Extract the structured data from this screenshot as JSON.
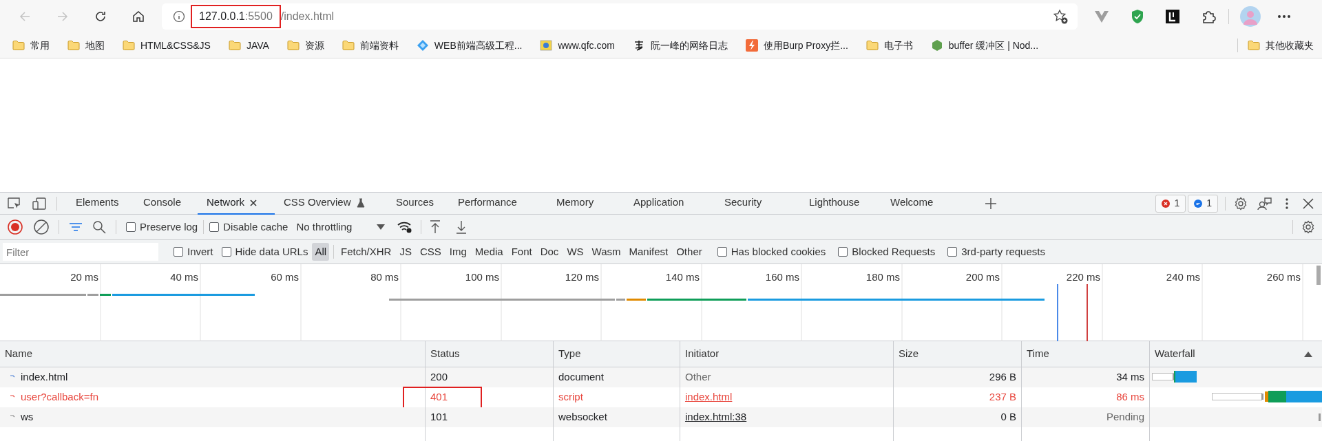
{
  "browser": {
    "url": {
      "host": "127.0.0.1",
      "port": ":5500",
      "path": "/index.html",
      "highlighted": true
    },
    "bookmarks": [
      {
        "label": "常用",
        "kind": "folder"
      },
      {
        "label": "地图",
        "kind": "folder"
      },
      {
        "label": "HTML&CSS&JS",
        "kind": "folder"
      },
      {
        "label": "JAVA",
        "kind": "folder"
      },
      {
        "label": "资源",
        "kind": "folder"
      },
      {
        "label": "前端资料",
        "kind": "folder"
      },
      {
        "label": "WEB前端高级工程...",
        "kind": "diamond"
      },
      {
        "label": "www.qfc.com",
        "kind": "qfc"
      },
      {
        "label": "阮一峰的网络日志",
        "kind": "calligraphy"
      },
      {
        "label": "使用Burp Proxy拦...",
        "kind": "bolt"
      },
      {
        "label": "电子书",
        "kind": "folder"
      },
      {
        "label": "buffer 缓冲区 | Nod...",
        "kind": "hexagon"
      }
    ],
    "other_bookmarks": "其他收藏夹"
  },
  "devtools": {
    "tabs": [
      {
        "label": "Elements",
        "selected": false,
        "kind": "plain"
      },
      {
        "label": "Console",
        "selected": false,
        "kind": "plain"
      },
      {
        "label": "Network",
        "selected": true,
        "kind": "closable"
      },
      {
        "label": "CSS Overview",
        "selected": false,
        "kind": "experimental"
      },
      {
        "label": "Sources",
        "selected": false,
        "kind": "plain"
      },
      {
        "label": "Performance",
        "selected": false,
        "kind": "plain"
      },
      {
        "label": "Memory",
        "selected": false,
        "kind": "plain"
      },
      {
        "label": "Application",
        "selected": false,
        "kind": "plain"
      },
      {
        "label": "Security",
        "selected": false,
        "kind": "plain"
      },
      {
        "label": "Lighthouse",
        "selected": false,
        "kind": "plain"
      },
      {
        "label": "Welcome",
        "selected": false,
        "kind": "plain"
      }
    ],
    "error_count": "1",
    "message_count": "1",
    "toolbar": {
      "recording": true,
      "preserve_log": {
        "label": "Preserve log",
        "checked": false
      },
      "disable_cache": {
        "label": "Disable cache",
        "checked": false
      },
      "throttling": "No throttling"
    },
    "filter": {
      "placeholder": "Filter",
      "invert": {
        "label": "Invert",
        "checked": false
      },
      "hide_data_urls": {
        "label": "Hide data URLs",
        "checked": false
      },
      "types": [
        {
          "label": "All",
          "selected": true
        },
        {
          "label": "Fetch/XHR",
          "selected": false
        },
        {
          "label": "JS",
          "selected": false
        },
        {
          "label": "CSS",
          "selected": false
        },
        {
          "label": "Img",
          "selected": false
        },
        {
          "label": "Media",
          "selected": false
        },
        {
          "label": "Font",
          "selected": false
        },
        {
          "label": "Doc",
          "selected": false
        },
        {
          "label": "WS",
          "selected": false
        },
        {
          "label": "Wasm",
          "selected": false
        },
        {
          "label": "Manifest",
          "selected": false
        },
        {
          "label": "Other",
          "selected": false
        }
      ],
      "options": [
        {
          "label": "Has blocked cookies",
          "checked": false
        },
        {
          "label": "Blocked Requests",
          "checked": false
        },
        {
          "label": "3rd-party requests",
          "checked": false
        }
      ]
    },
    "overview": {
      "ticks": [
        "20 ms",
        "40 ms",
        "60 ms",
        "80 ms",
        "100 ms",
        "120 ms",
        "140 ms",
        "160 ms",
        "180 ms",
        "200 ms",
        "220 ms",
        "240 ms",
        "260 ms"
      ]
    },
    "table": {
      "columns": [
        {
          "label": "Name",
          "sorted": false
        },
        {
          "label": "Status",
          "sorted": false
        },
        {
          "label": "Type",
          "sorted": false
        },
        {
          "label": "Initiator",
          "sorted": false
        },
        {
          "label": "Size",
          "sorted": false
        },
        {
          "label": "Time",
          "sorted": false
        },
        {
          "label": "Waterfall",
          "sorted": true
        }
      ],
      "rows": [
        {
          "name": "index.html",
          "status": "200",
          "type": "document",
          "initiator": "Other",
          "initiator_link": false,
          "size": "296 B",
          "time": "34 ms",
          "failed": false,
          "pending": false,
          "status_highlighted": false
        },
        {
          "name": "user?callback=fn",
          "status": "401",
          "type": "script",
          "initiator": "index.html",
          "initiator_link": true,
          "size": "237 B",
          "time": "86 ms",
          "failed": true,
          "pending": false,
          "status_highlighted": true
        },
        {
          "name": "ws",
          "status": "101",
          "type": "websocket",
          "initiator": "index.html:38",
          "initiator_link": true,
          "size": "0 B",
          "time": "Pending",
          "failed": false,
          "pending": true,
          "status_highlighted": false
        }
      ]
    }
  }
}
